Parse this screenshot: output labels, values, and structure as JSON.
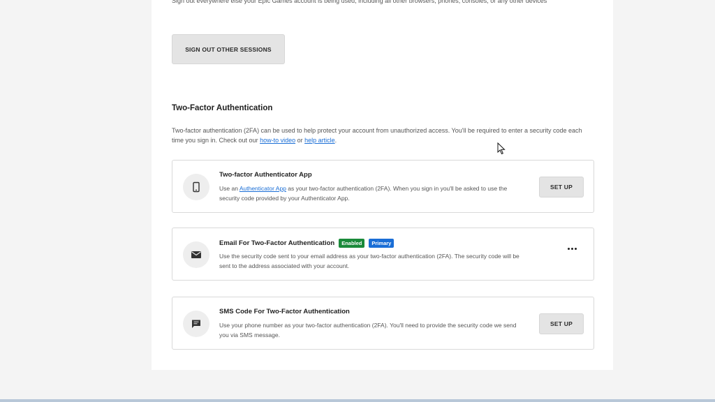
{
  "sessions": {
    "description": "Sign out everywhere else your Epic Games account is being used, including all other browsers, phones, consoles, or any other devices",
    "signout_label": "SIGN OUT OTHER SESSIONS"
  },
  "two_factor": {
    "title": "Two-Factor Authentication",
    "desc_before": "Two-factor authentication (2FA) can be used to help protect your account from unauthorized access. You'll be required to enter a security code each time you sign in. Check out our ",
    "link_video": "how-to video",
    "desc_or": " or ",
    "link_article": "help article",
    "desc_end": "."
  },
  "methods": {
    "app": {
      "icon": "phone-icon",
      "title": "Two-factor Authenticator App",
      "desc_before": "Use an ",
      "link": "Authenticator App",
      "desc_after": " as your two-factor authentication (2FA). When you sign in you'll be asked to use the security code provided by your Authenticator App.",
      "button": "SET UP"
    },
    "email": {
      "icon": "mail-icon",
      "title": "Email For Two-Factor Authentication",
      "badge_enabled": "Enabled",
      "badge_primary": "Primary",
      "desc": "Use the security code sent to your email address as your two-factor authentication (2FA). The security code will be sent to the address associated with your account."
    },
    "sms": {
      "icon": "chat-icon",
      "title": "SMS Code For Two-Factor Authentication",
      "desc": "Use your phone number as your two-factor authentication (2FA). You'll need to provide the security code we send you via SMS message.",
      "button": "SET UP"
    }
  },
  "colors": {
    "link": "#1a6ed6",
    "badge_enabled": "#1a8a3a",
    "badge_primary": "#1a6ed6"
  }
}
